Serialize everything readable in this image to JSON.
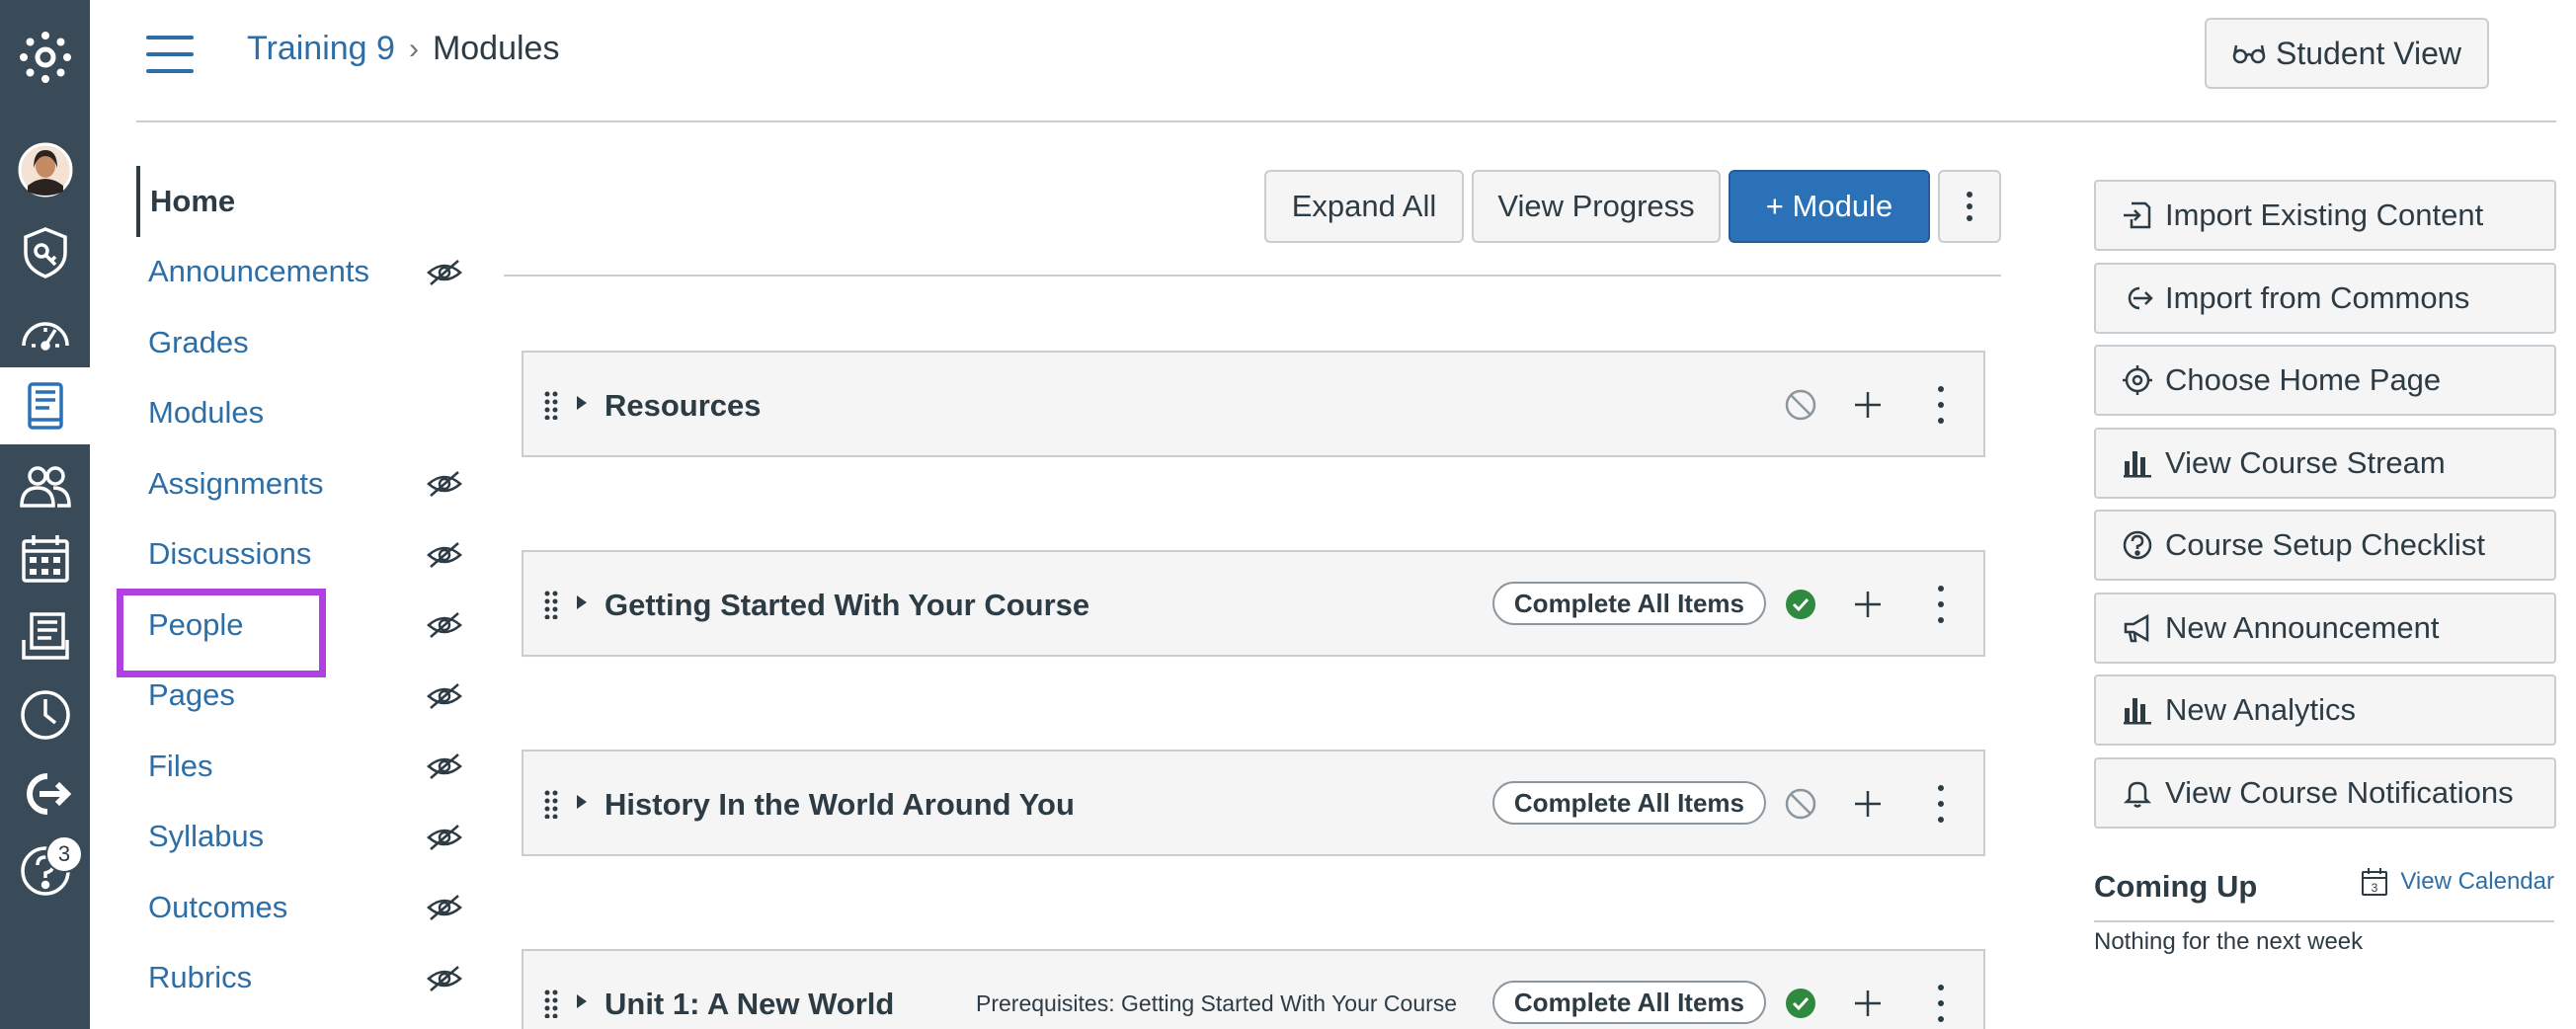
{
  "global_nav": {
    "items": [
      {
        "icon": "canvas-logo-icon"
      },
      {
        "icon": "account-avatar-icon"
      },
      {
        "icon": "admin-icon"
      },
      {
        "icon": "dashboard-icon"
      },
      {
        "icon": "courses-icon",
        "active": true
      },
      {
        "icon": "groups-icon"
      },
      {
        "icon": "calendar-icon"
      },
      {
        "icon": "inbox-icon"
      },
      {
        "icon": "history-icon"
      },
      {
        "icon": "commons-icon"
      },
      {
        "icon": "help-icon",
        "badge": "3"
      }
    ]
  },
  "header": {
    "breadcrumb_course": "Training 9",
    "breadcrumb_sep": "›",
    "breadcrumb_current": "Modules",
    "student_view_label": "Student View"
  },
  "course_nav": {
    "items": [
      {
        "label": "Home"
      },
      {
        "label": "Announcements"
      },
      {
        "label": "Grades"
      },
      {
        "label": "Modules"
      },
      {
        "label": "Assignments"
      },
      {
        "label": "Discussions"
      },
      {
        "label": "People"
      },
      {
        "label": "Pages"
      },
      {
        "label": "Files"
      },
      {
        "label": "Syllabus"
      },
      {
        "label": "Outcomes"
      },
      {
        "label": "Rubrics"
      }
    ]
  },
  "toolbar": {
    "expand_all": "Expand All",
    "view_progress": "View Progress",
    "add_module": "+ Module"
  },
  "modules": [
    {
      "title": "Resources",
      "prereq": "",
      "pill": "",
      "status": "unpublished"
    },
    {
      "title": "Getting Started With Your Course",
      "prereq": "",
      "pill": "Complete All Items",
      "status": "published"
    },
    {
      "title": "History In the World Around You",
      "prereq": "",
      "pill": "Complete All Items",
      "status": "unpublished"
    },
    {
      "title": "Unit 1: A New World",
      "prereq": "Prerequisites: Getting Started With Your Course",
      "pill": "Complete All Items",
      "status": "published"
    }
  ],
  "sidebar": {
    "buttons": [
      {
        "label": "Import Existing Content",
        "icon": "import-icon"
      },
      {
        "label": "Import from Commons",
        "icon": "commons-icon"
      },
      {
        "label": "Choose Home Page",
        "icon": "target-icon"
      },
      {
        "label": "View Course Stream",
        "icon": "bar-chart-icon"
      },
      {
        "label": "Course Setup Checklist",
        "icon": "question-icon"
      },
      {
        "label": "New Announcement",
        "icon": "megaphone-icon"
      },
      {
        "label": "New Analytics",
        "icon": "bar-chart-icon"
      },
      {
        "label": "View Course Notifications",
        "icon": "bell-icon"
      }
    ],
    "coming_up_title": "Coming Up",
    "view_calendar": "View Calendar",
    "calendar_day": "3",
    "nothing_text": "Nothing for the next week"
  },
  "colors": {
    "nav_bg": "#394b58",
    "link": "#2d6ea7",
    "primary": "#2b71b8",
    "success": "#2f8a3f",
    "highlight": "#b040e0"
  }
}
